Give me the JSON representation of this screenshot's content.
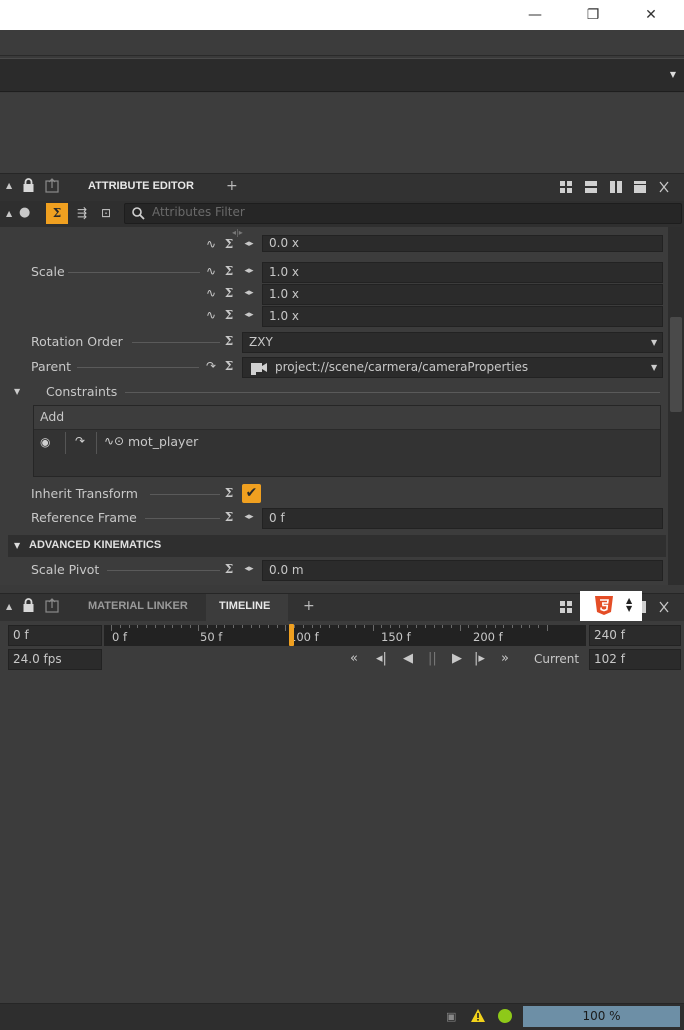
{
  "window": {
    "minimize_icon": "—",
    "maximize_icon": "❐",
    "close_icon": "✕"
  },
  "attribute_editor": {
    "tab_label": "ATTRIBUTE EDITOR",
    "add_tab": "+",
    "filter_placeholder": "Attributes Filter",
    "partial_value": "0.0 x",
    "scale": {
      "label": "Scale",
      "values": [
        "1.0 x",
        "1.0 x",
        "1.0 x"
      ]
    },
    "rotation_order": {
      "label": "Rotation Order",
      "value": "ZXY"
    },
    "parent": {
      "label": "Parent",
      "value": "project://scene/carmera/cameraProperties"
    },
    "constraints": {
      "label": "Constraints",
      "add_label": "Add",
      "item": "mot_player"
    },
    "inherit_transform": {
      "label": "Inherit Transform",
      "checked": true
    },
    "reference_frame": {
      "label": "Reference Frame",
      "value": "0 f"
    },
    "advanced_kinematics": {
      "label": "ADVANCED KINEMATICS"
    },
    "scale_pivot": {
      "label": "Scale Pivot",
      "value": "0.0 m"
    }
  },
  "timeline": {
    "tabs": [
      "MATERIAL LINKER",
      "TIMELINE"
    ],
    "active_tab": "TIMELINE",
    "add_tab": "+",
    "start": "0 f",
    "end": "240 f",
    "fps": "24.0 fps",
    "ruler_labels": [
      "0 f",
      "50 f",
      "100 f",
      "150 f",
      "200 f"
    ],
    "current_label": "Current",
    "current_value": "102 f",
    "playhead_frame": 102,
    "range": [
      0,
      240
    ]
  },
  "status": {
    "zoom": "100 %"
  },
  "colors": {
    "accent": "#f0a020",
    "status_ok": "#8ec919",
    "warning": "#f2d21b",
    "zoom_bar": "#6d8fa6"
  }
}
